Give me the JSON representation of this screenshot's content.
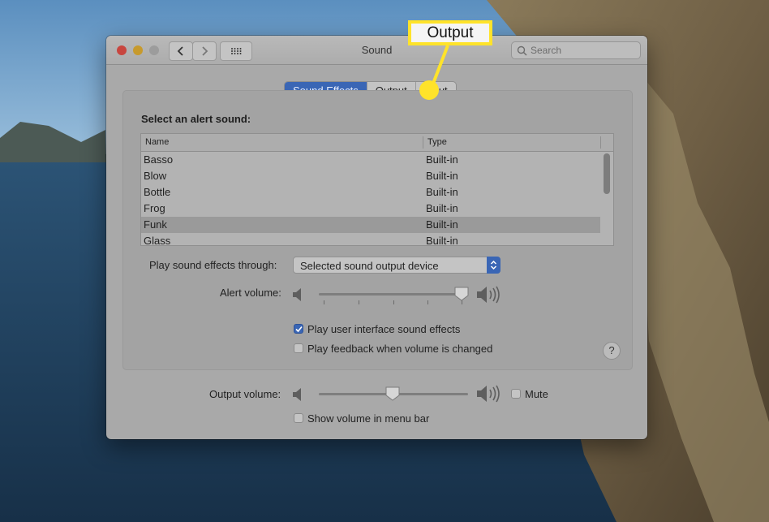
{
  "window": {
    "title": "Sound",
    "search_placeholder": "Search"
  },
  "tabs": [
    {
      "label": "Sound Effects",
      "active": true
    },
    {
      "label": "Output",
      "active": false
    },
    {
      "label": "Input",
      "active": false
    }
  ],
  "alerts": {
    "heading": "Select an alert sound:",
    "columns": [
      "Name",
      "Type"
    ],
    "rows": [
      {
        "name": "Basso",
        "type": "Built-in"
      },
      {
        "name": "Blow",
        "type": "Built-in"
      },
      {
        "name": "Bottle",
        "type": "Built-in"
      },
      {
        "name": "Frog",
        "type": "Built-in"
      },
      {
        "name": "Funk",
        "type": "Built-in",
        "selected": true
      },
      {
        "name": "Glass",
        "type": "Built-in"
      }
    ]
  },
  "play_through": {
    "label": "Play sound effects through:",
    "value": "Selected sound output device"
  },
  "alert_volume": {
    "label": "Alert volume:",
    "level": 0.95
  },
  "checkboxes": {
    "ui_sounds": {
      "label": "Play user interface sound effects",
      "checked": true
    },
    "feedback": {
      "label": "Play feedback when volume is changed",
      "checked": false
    },
    "show_menu": {
      "label": "Show volume in menu bar",
      "checked": false
    },
    "mute": {
      "label": "Mute",
      "checked": false
    }
  },
  "output_volume": {
    "label": "Output volume:",
    "level": 0.5
  },
  "help_glyph": "?",
  "callout": {
    "text": "Output"
  },
  "colors": {
    "accent": "#3a66b5",
    "callout": "#ffe32a"
  }
}
